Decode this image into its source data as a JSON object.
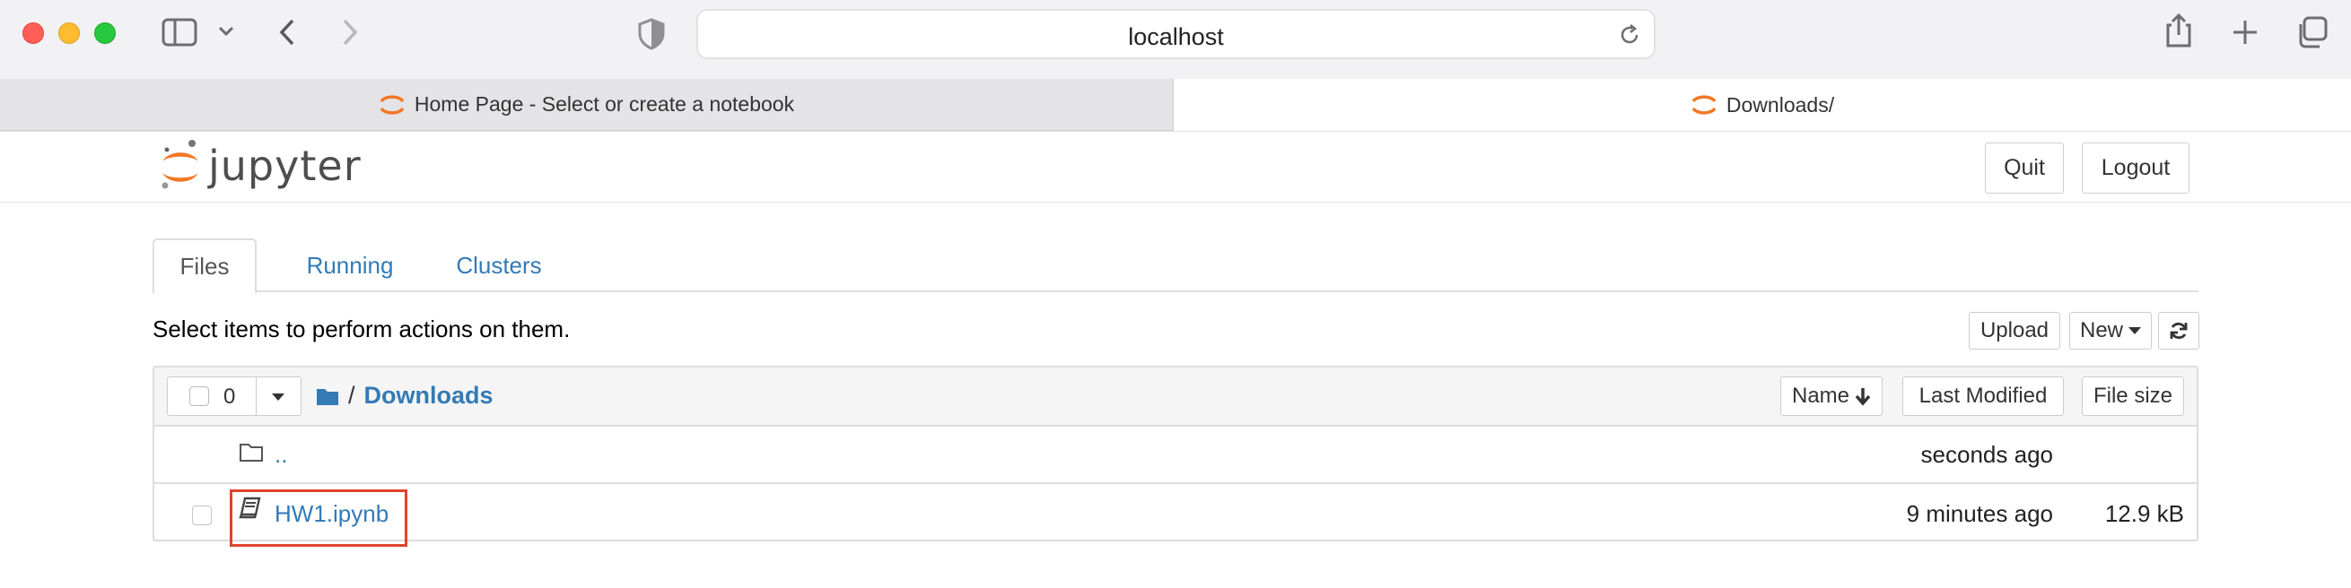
{
  "browser": {
    "url": "localhost",
    "tabs": [
      {
        "title": "Home Page - Select or create a notebook",
        "active": false
      },
      {
        "title": "Downloads/",
        "active": true
      }
    ]
  },
  "jupyter": {
    "logo_text": "jupyter",
    "header_buttons": {
      "quit": "Quit",
      "logout": "Logout"
    },
    "nav_tabs": [
      "Files",
      "Running",
      "Clusters"
    ],
    "select_message": "Select items to perform actions on them.",
    "actions": {
      "upload": "Upload",
      "new": "New"
    },
    "selection_count": "0",
    "breadcrumb": {
      "separator": "/",
      "folder": "Downloads"
    },
    "columns": {
      "name": "Name",
      "last_modified": "Last Modified",
      "file_size": "File size"
    },
    "rows": [
      {
        "name": "..",
        "modified": "seconds ago",
        "size": "",
        "type": "folder-icon"
      },
      {
        "name": "HW1.ipynb",
        "modified": "9 minutes ago",
        "size": "12.9 kB",
        "type": "notebook-icon"
      }
    ]
  },
  "colors": {
    "link": "#337ab7",
    "jupyter_orange": "#f37726",
    "highlight": "#e0432c"
  }
}
